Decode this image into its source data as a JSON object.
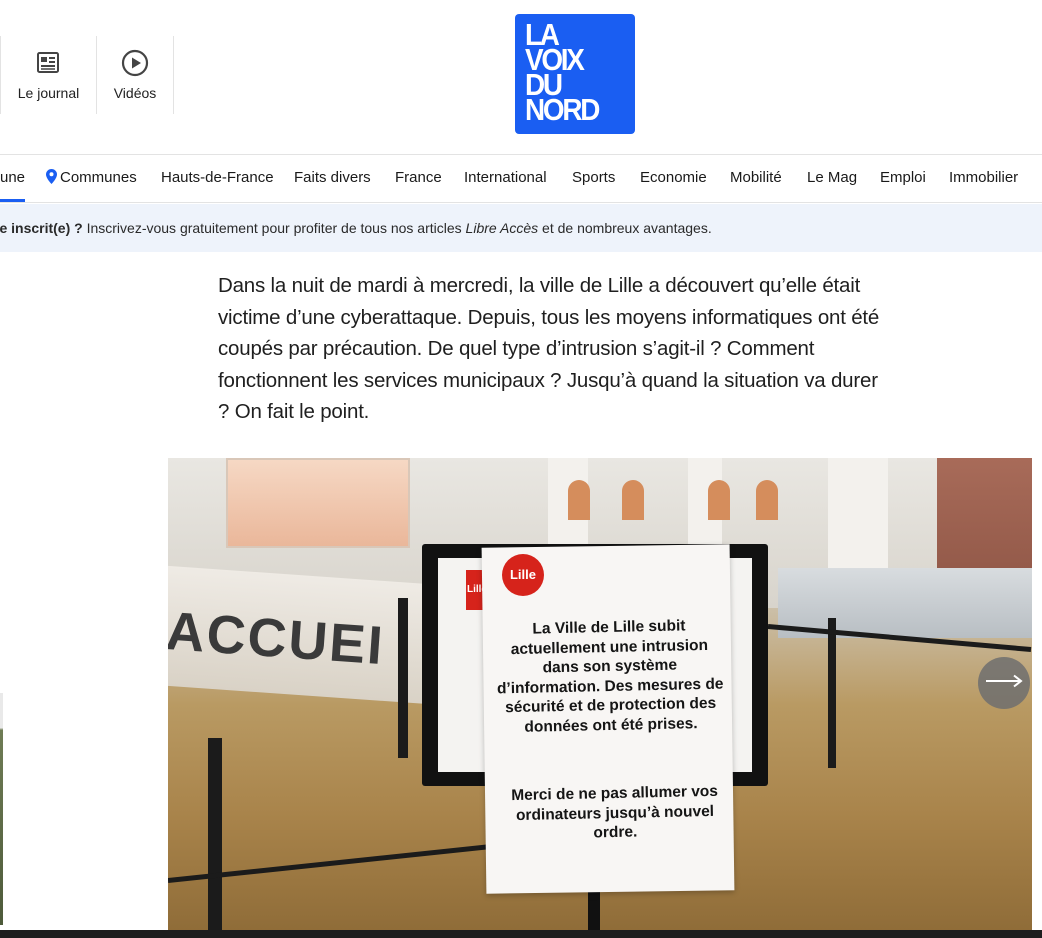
{
  "header": {
    "quick_links": [
      {
        "label": "Le journal",
        "icon": "newspaper-icon"
      },
      {
        "label": "Vidéos",
        "icon": "play-circle-icon"
      }
    ],
    "logo_lines": [
      "LA",
      "VOIX",
      "DU",
      "NORD"
    ],
    "brand_color": "#1a5ef2"
  },
  "nav": {
    "items": [
      {
        "label": "une",
        "active": true
      },
      {
        "label": "Communes",
        "icon": "location-pin-icon"
      },
      {
        "label": "Hauts-de-France"
      },
      {
        "label": "Faits divers"
      },
      {
        "label": "France"
      },
      {
        "label": "International"
      },
      {
        "label": "Sports"
      },
      {
        "label": "Economie"
      },
      {
        "label": "Mobilité"
      },
      {
        "label": "Le Mag"
      },
      {
        "label": "Emploi"
      },
      {
        "label": "Immobilier"
      }
    ]
  },
  "banner": {
    "bold": "re inscrit(e) ?",
    "text": " Inscrivez-vous gratuitement pour profiter de tous nos articles ",
    "italic": "Libre Accès",
    "text_end": " et de nombreux avantages."
  },
  "article": {
    "lead": "Dans la nuit de mardi à mercredi, la ville de Lille a découvert qu’elle était victime d’une cyberattaque. Depuis, tous les moyens informatiques ont été coupés par précaution. De quel type d’intrusion s’agit-il ? Comment fonctionnent les services municipaux ? Jusqu’à quand la situation va durer ? On fait le point."
  },
  "photo": {
    "desk_sign": "ACCUEI",
    "logo_text": "Lille",
    "notice_main": "La Ville de Lille subit actuellement une intrusion dans son système d’information. Des mesures de sécurité et de protection des données ont été prises.",
    "notice_second": "Merci de ne pas allumer vos ordinateurs jusqu’à nouvel ordre."
  },
  "carousel": {
    "next_icon": "arrow-right-icon"
  }
}
